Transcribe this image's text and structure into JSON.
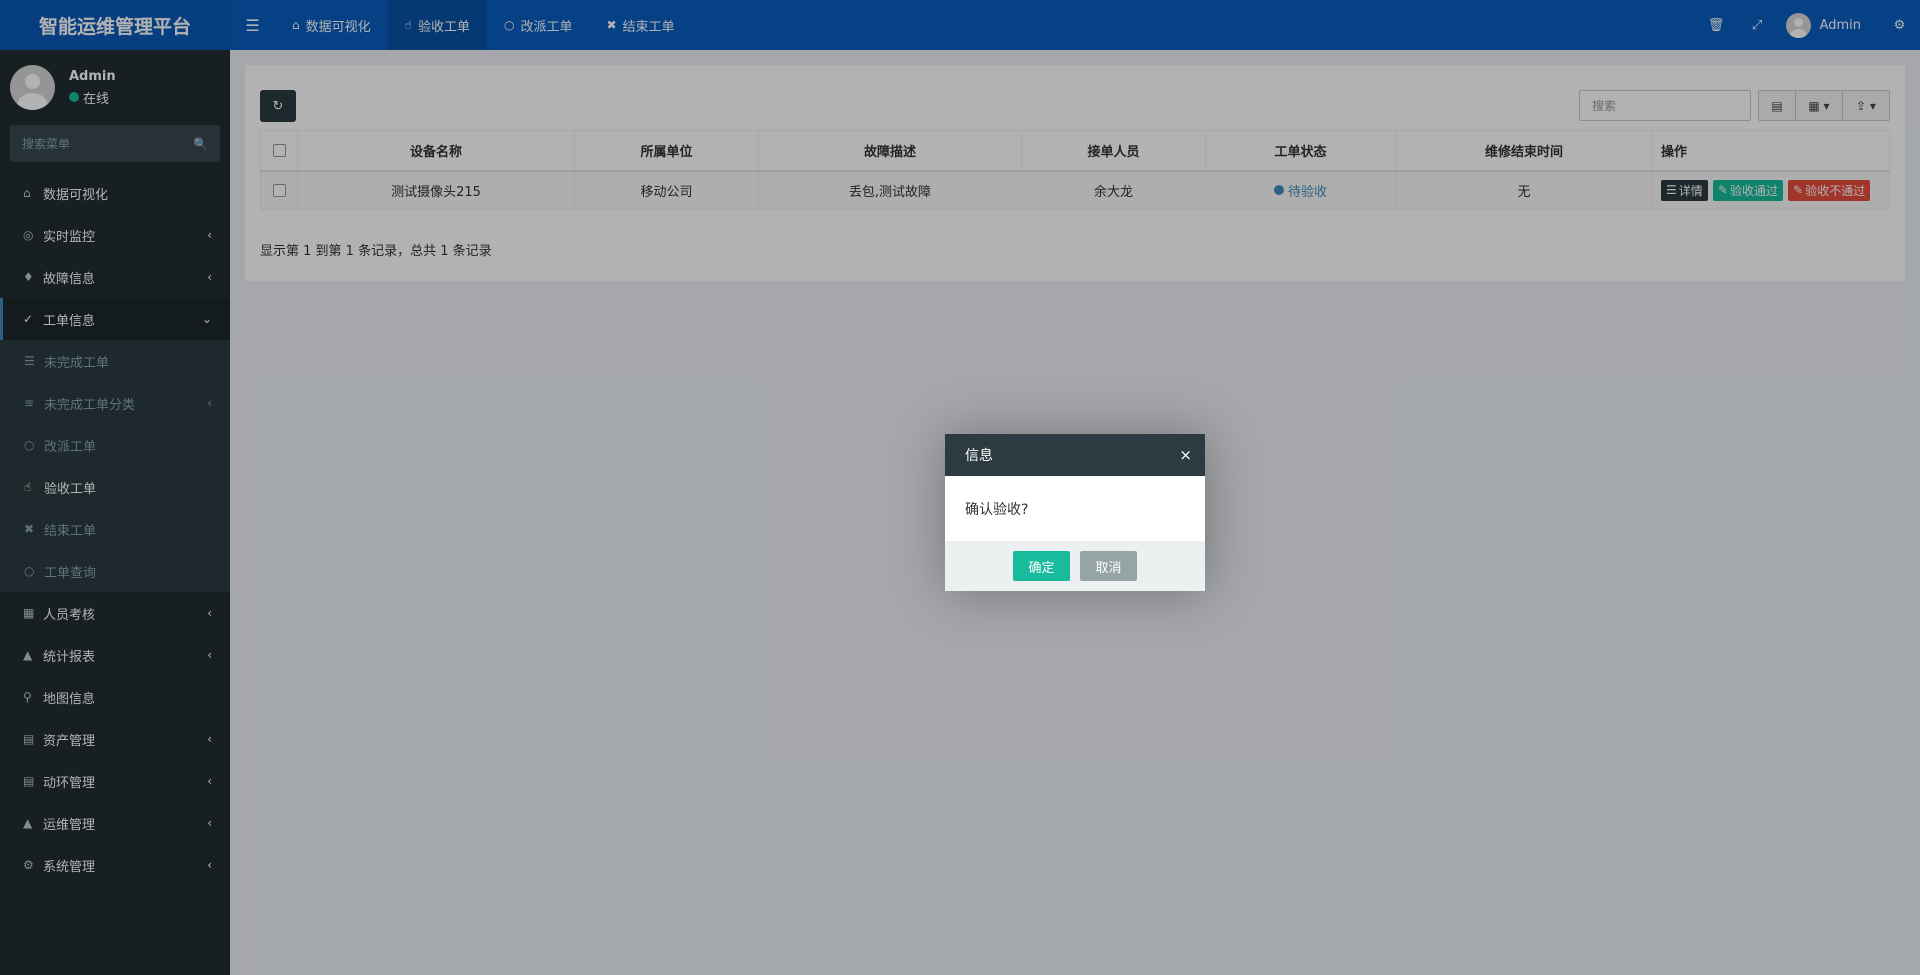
{
  "header": {
    "brand": "智能运维管理平台",
    "tabs": [
      {
        "icon": "home-icon",
        "label": "数据可视化"
      },
      {
        "icon": "thumbs-up-icon",
        "label": "验收工单"
      },
      {
        "icon": "circle-icon",
        "label": "改派工单"
      },
      {
        "icon": "times-icon",
        "label": "结束工单"
      }
    ],
    "user": "Admin"
  },
  "sidebar": {
    "user_name": "Admin",
    "user_status": "在线",
    "search_placeholder": "搜索菜单",
    "items": [
      {
        "label": "数据可视化"
      },
      {
        "label": "实时监控"
      },
      {
        "label": "故障信息"
      },
      {
        "label": "工单信息"
      },
      {
        "label": "人员考核"
      },
      {
        "label": "统计报表"
      },
      {
        "label": "地图信息"
      },
      {
        "label": "资产管理"
      },
      {
        "label": "动环管理"
      },
      {
        "label": "运维管理"
      },
      {
        "label": "系统管理"
      }
    ],
    "submenu": [
      {
        "label": "未完成工单"
      },
      {
        "label": "未完成工单分类"
      },
      {
        "label": "改派工单"
      },
      {
        "label": "验收工单"
      },
      {
        "label": "结束工单"
      },
      {
        "label": "工单查询"
      }
    ]
  },
  "toolbar": {
    "search_placeholder": "搜索"
  },
  "table": {
    "columns": [
      "设备名称",
      "所属单位",
      "故障描述",
      "接单人员",
      "工单状态",
      "维修结束时间",
      "操作"
    ],
    "rows": [
      {
        "device": "测试摄像头215",
        "unit": "移动公司",
        "fault": "丢包,测试故障",
        "worker": "余大龙",
        "status": "待验收",
        "end_time": "无",
        "actions": [
          "详情",
          "验收通过",
          "验收不通过"
        ]
      }
    ],
    "pagination": "显示第 1 到第 1 条记录，总共 1 条记录"
  },
  "dialog": {
    "title": "信息",
    "close": "×",
    "message": "确认验收?",
    "ok": "确定",
    "cancel": "取消"
  }
}
